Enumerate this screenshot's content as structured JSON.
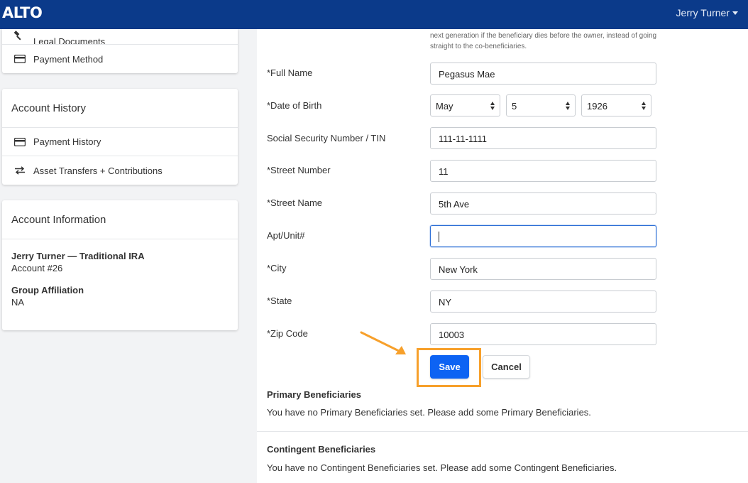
{
  "header": {
    "logo": "ALTO",
    "user_name": "Jerry Turner"
  },
  "sidebar": {
    "top_card": {
      "items": [
        {
          "label": "Legal Documents",
          "icon": "gavel-icon"
        },
        {
          "label": "Payment Method",
          "icon": "credit-card-icon"
        }
      ]
    },
    "account_history": {
      "title": "Account History",
      "items": [
        {
          "label": "Payment History",
          "icon": "credit-card-icon"
        },
        {
          "label": "Asset Transfers + Contributions",
          "icon": "transfer-arrows-icon"
        }
      ]
    },
    "account_information": {
      "title": "Account Information",
      "account_name": "Jerry Turner — Traditional IRA",
      "account_number": "Account #26",
      "group_label": "Group Affiliation",
      "group_value": "NA"
    }
  },
  "form": {
    "help_text": "next generation if the beneficiary dies before the owner, instead of going straight to the co-beneficiaries.",
    "full_name": {
      "label": "*Full Name",
      "value": "Pegasus Mae"
    },
    "dob": {
      "label": "*Date of Birth",
      "month": "May",
      "day": "5",
      "year": "1926"
    },
    "ssn": {
      "label": "Social Security Number / TIN",
      "value": "111-11-1111"
    },
    "street_number": {
      "label": "*Street Number",
      "value": "11"
    },
    "street_name": {
      "label": "*Street Name",
      "value": "5th Ave"
    },
    "apt": {
      "label": "Apt/Unit#",
      "value": ""
    },
    "city": {
      "label": "*City",
      "value": "New York"
    },
    "state": {
      "label": "*State",
      "value": "NY"
    },
    "zip": {
      "label": "*Zip Code",
      "value": "10003"
    },
    "save_label": "Save",
    "cancel_label": "Cancel",
    "highlight_color": "#f7a02b"
  },
  "beneficiaries": {
    "primary_title": "Primary Beneficiaries",
    "primary_text": "You have no Primary Beneficiaries set. Please add some Primary Beneficiaries.",
    "contingent_title": "Contingent Beneficiaries",
    "contingent_text": "You have no Contingent Beneficiaries set. Please add some Contingent Beneficiaries."
  }
}
